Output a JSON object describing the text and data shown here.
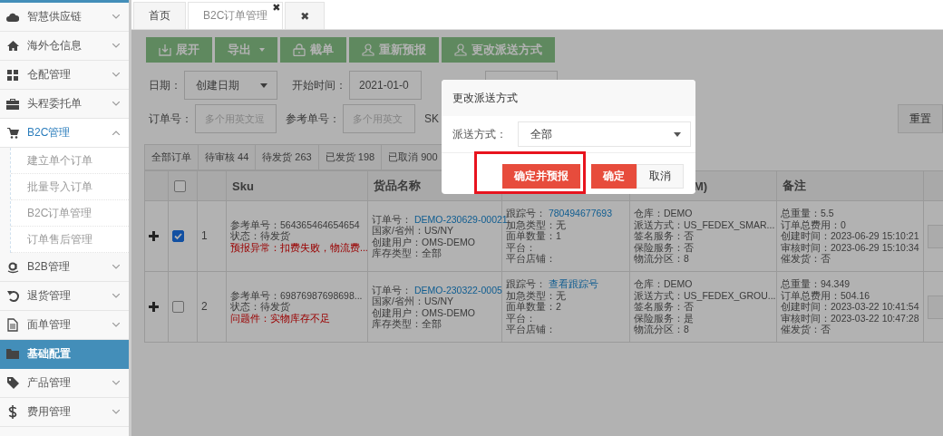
{
  "sidebar": {
    "items": [
      {
        "label": "智慧供应链",
        "kind": "group",
        "expanded": false,
        "selected": false
      },
      {
        "label": "海外仓信息",
        "kind": "group",
        "expanded": false,
        "selected": false
      },
      {
        "label": "仓配管理",
        "kind": "group",
        "expanded": false,
        "selected": false
      },
      {
        "label": "头程委托单",
        "kind": "group",
        "expanded": false,
        "selected": false
      },
      {
        "label": "B2C管理",
        "kind": "group",
        "expanded": true,
        "selected": false,
        "children": [
          {
            "label": "建立单个订单",
            "selected": false
          },
          {
            "label": "批量导入订单",
            "selected": false
          },
          {
            "label": "B2C订单管理",
            "selected": false
          },
          {
            "label": "订单售后管理",
            "selected": false
          }
        ]
      },
      {
        "label": "B2B管理",
        "kind": "group",
        "expanded": false,
        "selected": false
      },
      {
        "label": "退货管理",
        "kind": "group",
        "expanded": false,
        "selected": false
      },
      {
        "label": "面单管理",
        "kind": "group",
        "expanded": false,
        "selected": false
      },
      {
        "label": "基础配置",
        "kind": "link",
        "selected": true
      },
      {
        "label": "产品管理",
        "kind": "group",
        "expanded": false,
        "selected": false
      },
      {
        "label": "费用管理",
        "kind": "group",
        "expanded": false,
        "selected": false
      }
    ]
  },
  "tabs": [
    {
      "label": "首页",
      "selected": false
    },
    {
      "label": "B2C订单管理",
      "selected": true,
      "close": "✖"
    },
    {
      "label": "✖",
      "selected": false
    }
  ],
  "toolbar": [
    {
      "label": "展开",
      "kind": "download"
    },
    {
      "label": "导出",
      "kind": "dropdown"
    },
    {
      "label": "截单",
      "kind": "lock"
    },
    {
      "label": "重新预报",
      "kind": "user"
    },
    {
      "label": "更改派送方式",
      "kind": "user"
    }
  ],
  "filters": {
    "date_label": "日期：",
    "date_select": "创建日期",
    "start_label": "开始时间：",
    "start_value": "2021-01-0",
    "order_label": "订单号：",
    "order_placeholder": "多个用英文逗",
    "ref_label": "参考单号：",
    "ref_placeholder": "多个用英文",
    "sku_label": "SK",
    "reset": "重置"
  },
  "status_tabs": [
    {
      "label": "全部订单",
      "selected": false
    },
    {
      "label": "待审核 44",
      "selected": false
    },
    {
      "label": "待发货 263",
      "selected": false
    },
    {
      "label": "已发货 198",
      "selected": false
    },
    {
      "label": "已取消 900",
      "selected": false
    }
  ],
  "table": {
    "header": {
      "checked": false,
      "sku": "Sku",
      "goods": "货品名称",
      "column_7": "M)",
      "remark": "备注"
    },
    "rows": [
      {
        "checked": true,
        "index": "1",
        "cells": [
          [
            {
              "text": "参考单号：564365464654654",
              "kind": "plain"
            },
            {
              "text": "状态：待发货",
              "kind": "plain"
            },
            {
              "text": "预报异常：扣费失败，物流费...",
              "kind": "alert"
            }
          ],
          [
            {
              "text": "订单号：",
              "kind": "link",
              "link": "DEMO-230629-00021"
            },
            {
              "text": "国家/省州：US/NY",
              "kind": "plain"
            },
            {
              "text": "创建用户：OMS-DEMO",
              "kind": "plain"
            },
            {
              "text": "库存类型：全部",
              "kind": "plain"
            }
          ],
          [
            {
              "text": "跟踪号：",
              "kind": "link",
              "link": "780494677693"
            },
            {
              "text": "加急类型：无",
              "kind": "plain"
            },
            {
              "text": "面单数量：1",
              "kind": "plain"
            },
            {
              "text": "平台：",
              "kind": "plain"
            },
            {
              "text": "平台店铺：",
              "kind": "plain"
            }
          ],
          [
            {
              "text": "仓库：DEMO",
              "kind": "plain"
            },
            {
              "text": "派送方式：US_FEDEX_SMAR...",
              "kind": "plain"
            },
            {
              "text": "签名服务：否",
              "kind": "plain"
            },
            {
              "text": "保险服务：否",
              "kind": "plain"
            },
            {
              "text": "物流分区：8",
              "kind": "plain"
            }
          ],
          [
            {
              "text": "总重量：5.5",
              "kind": "plain"
            },
            {
              "text": "订单总费用：0",
              "kind": "plain"
            },
            {
              "text": "创建时间：2023-06-29 15:10:21",
              "kind": "plain"
            },
            {
              "text": "审核时间：2023-06-29 15:10:34",
              "kind": "plain"
            },
            {
              "text": "催发货：否",
              "kind": "plain"
            }
          ]
        ]
      },
      {
        "checked": false,
        "index": "2",
        "cells": [
          [
            {
              "text": "参考单号：69876987698698...",
              "kind": "plain"
            },
            {
              "text": "状态：待发货",
              "kind": "plain"
            },
            {
              "text": "问题件：实物库存不足",
              "kind": "alert"
            }
          ],
          [
            {
              "text": "订单号：",
              "kind": "link",
              "link": "DEMO-230322-0005"
            },
            {
              "text": "国家/省州：US/NY",
              "kind": "plain"
            },
            {
              "text": "创建用户：OMS-DEMO",
              "kind": "plain"
            },
            {
              "text": "库存类型：全部",
              "kind": "plain"
            }
          ],
          [
            {
              "text": "跟踪号：",
              "kind": "link",
              "link": "查看跟踪号"
            },
            {
              "text": "加急类型：无",
              "kind": "plain"
            },
            {
              "text": "面单数量：2",
              "kind": "plain"
            },
            {
              "text": "平台：",
              "kind": "plain"
            },
            {
              "text": "平台店铺：",
              "kind": "plain"
            }
          ],
          [
            {
              "text": "仓库：DEMO",
              "kind": "plain"
            },
            {
              "text": "派送方式：US_FEDEX_GROU...",
              "kind": "plain"
            },
            {
              "text": "签名服务：否",
              "kind": "plain"
            },
            {
              "text": "保险服务：是",
              "kind": "plain"
            },
            {
              "text": "物流分区：8",
              "kind": "plain"
            }
          ],
          [
            {
              "text": "总重量：94.349",
              "kind": "plain"
            },
            {
              "text": "订单总费用：504.16",
              "kind": "plain"
            },
            {
              "text": "创建时间：2023-03-22 10:41:54",
              "kind": "plain"
            },
            {
              "text": "审核时间：2023-03-22 10:47:28",
              "kind": "plain"
            },
            {
              "text": "催发货：否",
              "kind": "plain"
            }
          ]
        ]
      }
    ]
  },
  "modal": {
    "title": "更改派送方式",
    "field_label": "派送方式：",
    "field_value": "全部",
    "buttons": [
      {
        "label": "确定并预报",
        "kind": "primary",
        "highlighted": true
      },
      {
        "label": "确定",
        "kind": "primary",
        "highlighted": false
      },
      {
        "label": "取消",
        "kind": "default",
        "highlighted": false
      }
    ]
  }
}
